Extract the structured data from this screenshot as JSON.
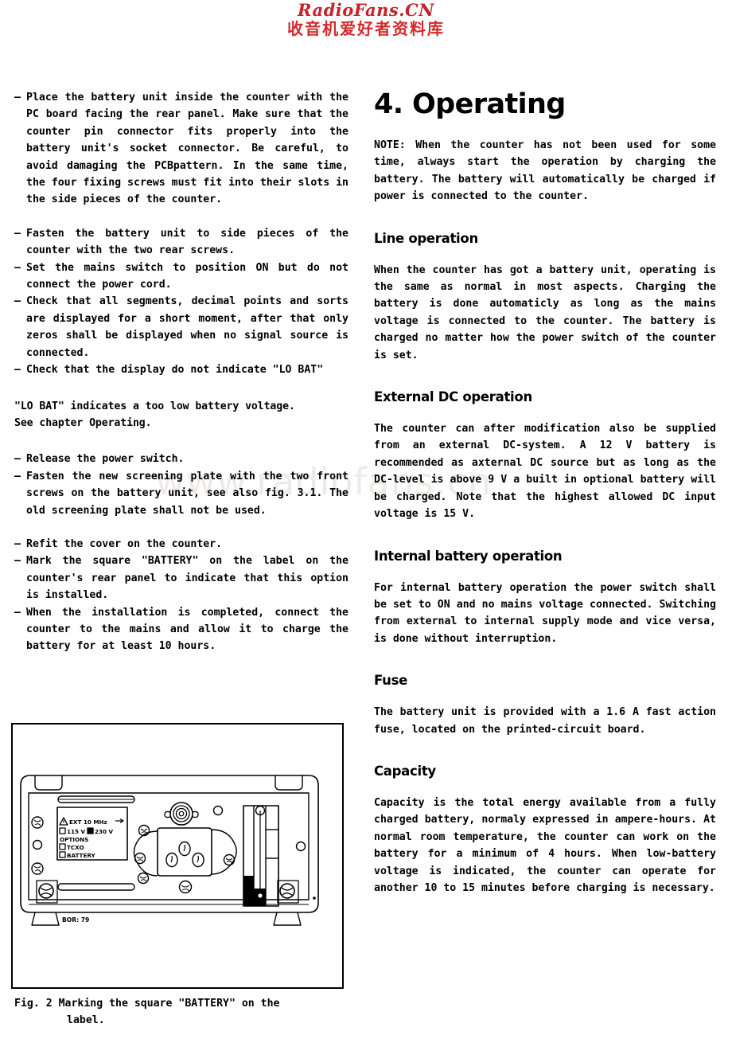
{
  "watermark": {
    "english": "RadioFans.CN",
    "chinese": "收音机爱好者资料库",
    "center": "www.radiofans.cn",
    "color_english": "#c7222a",
    "color_chinese": "#d42a2a",
    "color_center": "#efeaea"
  },
  "left_column": {
    "bullets_group_1": [
      "Place the battery unit inside the counter with the PC board facing the rear panel. Make sure that the counter pin connector fits properly into the battery unit's socket connector. Be careful, to avoid damaging the PCBpattern. In the same time, the four fixing screws must fit into their slots in the side pieces of the counter."
    ],
    "bullets_group_2": [
      "Fasten the battery unit to side pieces of the counter with the two rear screws.",
      "Set the mains switch to position ON but do not connect the power cord.",
      "Check that all segments, decimal points and sorts are displayed for a short moment, after that only zeros shall be displayed when no signal source is connected.",
      "Check that the display do not indicate \"LO BAT\""
    ],
    "note_bold_line_1": "\"LO BAT\" indicates a too low battery voltage.",
    "note_bold_line_2": "See chapter Operating.",
    "bullets_group_3": [
      "Release the power switch.",
      "Fasten the new screening plate with the two front screws on the battery unit, see also fig. 3.1. The old screening plate shall not be used."
    ],
    "bullets_group_4": [
      "Refit the cover on the counter.",
      "Mark the square \"BATTERY\" on the label on the counter's rear panel to indicate that this option is installed.",
      "When the installation is completed, connect the counter to the mains and allow it to charge the battery for at least 10 hours."
    ],
    "figure": {
      "caption_prefix": "Fig.  2 Marking  the  square  \"BATTERY\"  on  the",
      "caption_second_line": "label.",
      "panel_label": {
        "line1": "EXT 10 MHz",
        "opt_115": "115 V",
        "opt_230": "230 V",
        "options_title": "OPTIONS",
        "opt_tcxo": "TCXO",
        "opt_battery": "BATTERY"
      },
      "footer_mark": "BOR: 79"
    }
  },
  "right_column": {
    "chapter_title": "4. Operating",
    "note_paragraph": "NOTE: When the counter has not been used for some time, always start the operation by charging the battery. The battery will automatically be charged if power is connected to the counter.",
    "sections": [
      {
        "heading": "Line operation",
        "body": "When the counter has got a battery unit, operating is the same as normal in most aspects. Charging the battery is done automaticly as long as the mains voltage is connected to the counter. The battery is charged no matter how the power switch of the counter is set."
      },
      {
        "heading": "External DC operation",
        "body": "The counter can after modification also be supplied from an external DC-system. A 12 V battery is recommended as axternal DC source but as long as the DC-level is above 9 V a built in optional battery will be charged. Note that the highest allowed DC input voltage is 15 V."
      },
      {
        "heading": "Internal battery operation",
        "body": "For internal battery operation the power switch shall be set to ON and no mains voltage connected. Switching from external to internal supply mode and vice versa, is done without interruption."
      },
      {
        "heading": "Fuse",
        "body": "The battery unit is provided with a 1.6 A fast action fuse, located on the printed-circuit board."
      },
      {
        "heading": "Capacity",
        "body": "Capacity is the total energy available from a fully charged battery, normaly expressed in ampere-hours. At normal room temperature, the counter can work on the battery for a minimum of 4 hours. When low-battery voltage is indicated, the counter can operate for another 10 to 15 minutes before charging is necessary."
      }
    ]
  }
}
